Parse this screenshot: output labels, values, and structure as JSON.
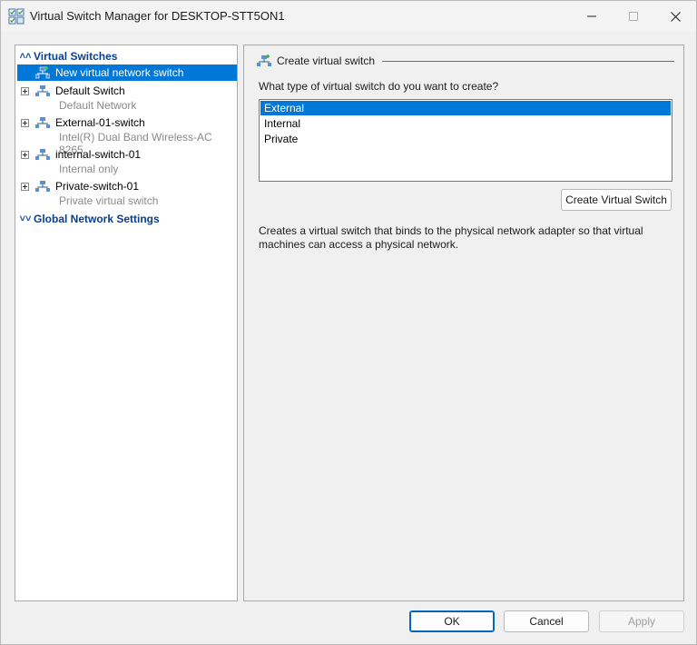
{
  "window": {
    "title": "Virtual Switch Manager for DESKTOP-STT5ON1"
  },
  "sidebar": {
    "virtual_switches_header": "Virtual Switches",
    "global_settings_header": "Global Network Settings",
    "items": [
      {
        "label": "New virtual network switch",
        "sublabel": "",
        "selected": true
      },
      {
        "label": "Default Switch",
        "sublabel": "Default Network",
        "selected": false
      },
      {
        "label": "External-01-switch",
        "sublabel": "Intel(R) Dual Band Wireless-AC 8265",
        "selected": false
      },
      {
        "label": "internal-switch-01",
        "sublabel": "Internal only",
        "selected": false
      },
      {
        "label": "Private-switch-01",
        "sublabel": "Private virtual switch",
        "selected": false
      }
    ]
  },
  "main": {
    "group_title": "Create virtual switch",
    "question": "What type of virtual switch do you want to create?",
    "options": [
      "External",
      "Internal",
      "Private"
    ],
    "selected_option": "External",
    "create_button": "Create Virtual Switch",
    "description": "Creates a virtual switch that binds to the physical network adapter so that virtual machines can access a physical network."
  },
  "footer": {
    "ok_label": "OK",
    "cancel_label": "Cancel",
    "apply_label": "Apply"
  },
  "colors": {
    "accent": "#0078d7",
    "header_text": "#0a3f8c",
    "muted_text": "#8a8a8a"
  }
}
